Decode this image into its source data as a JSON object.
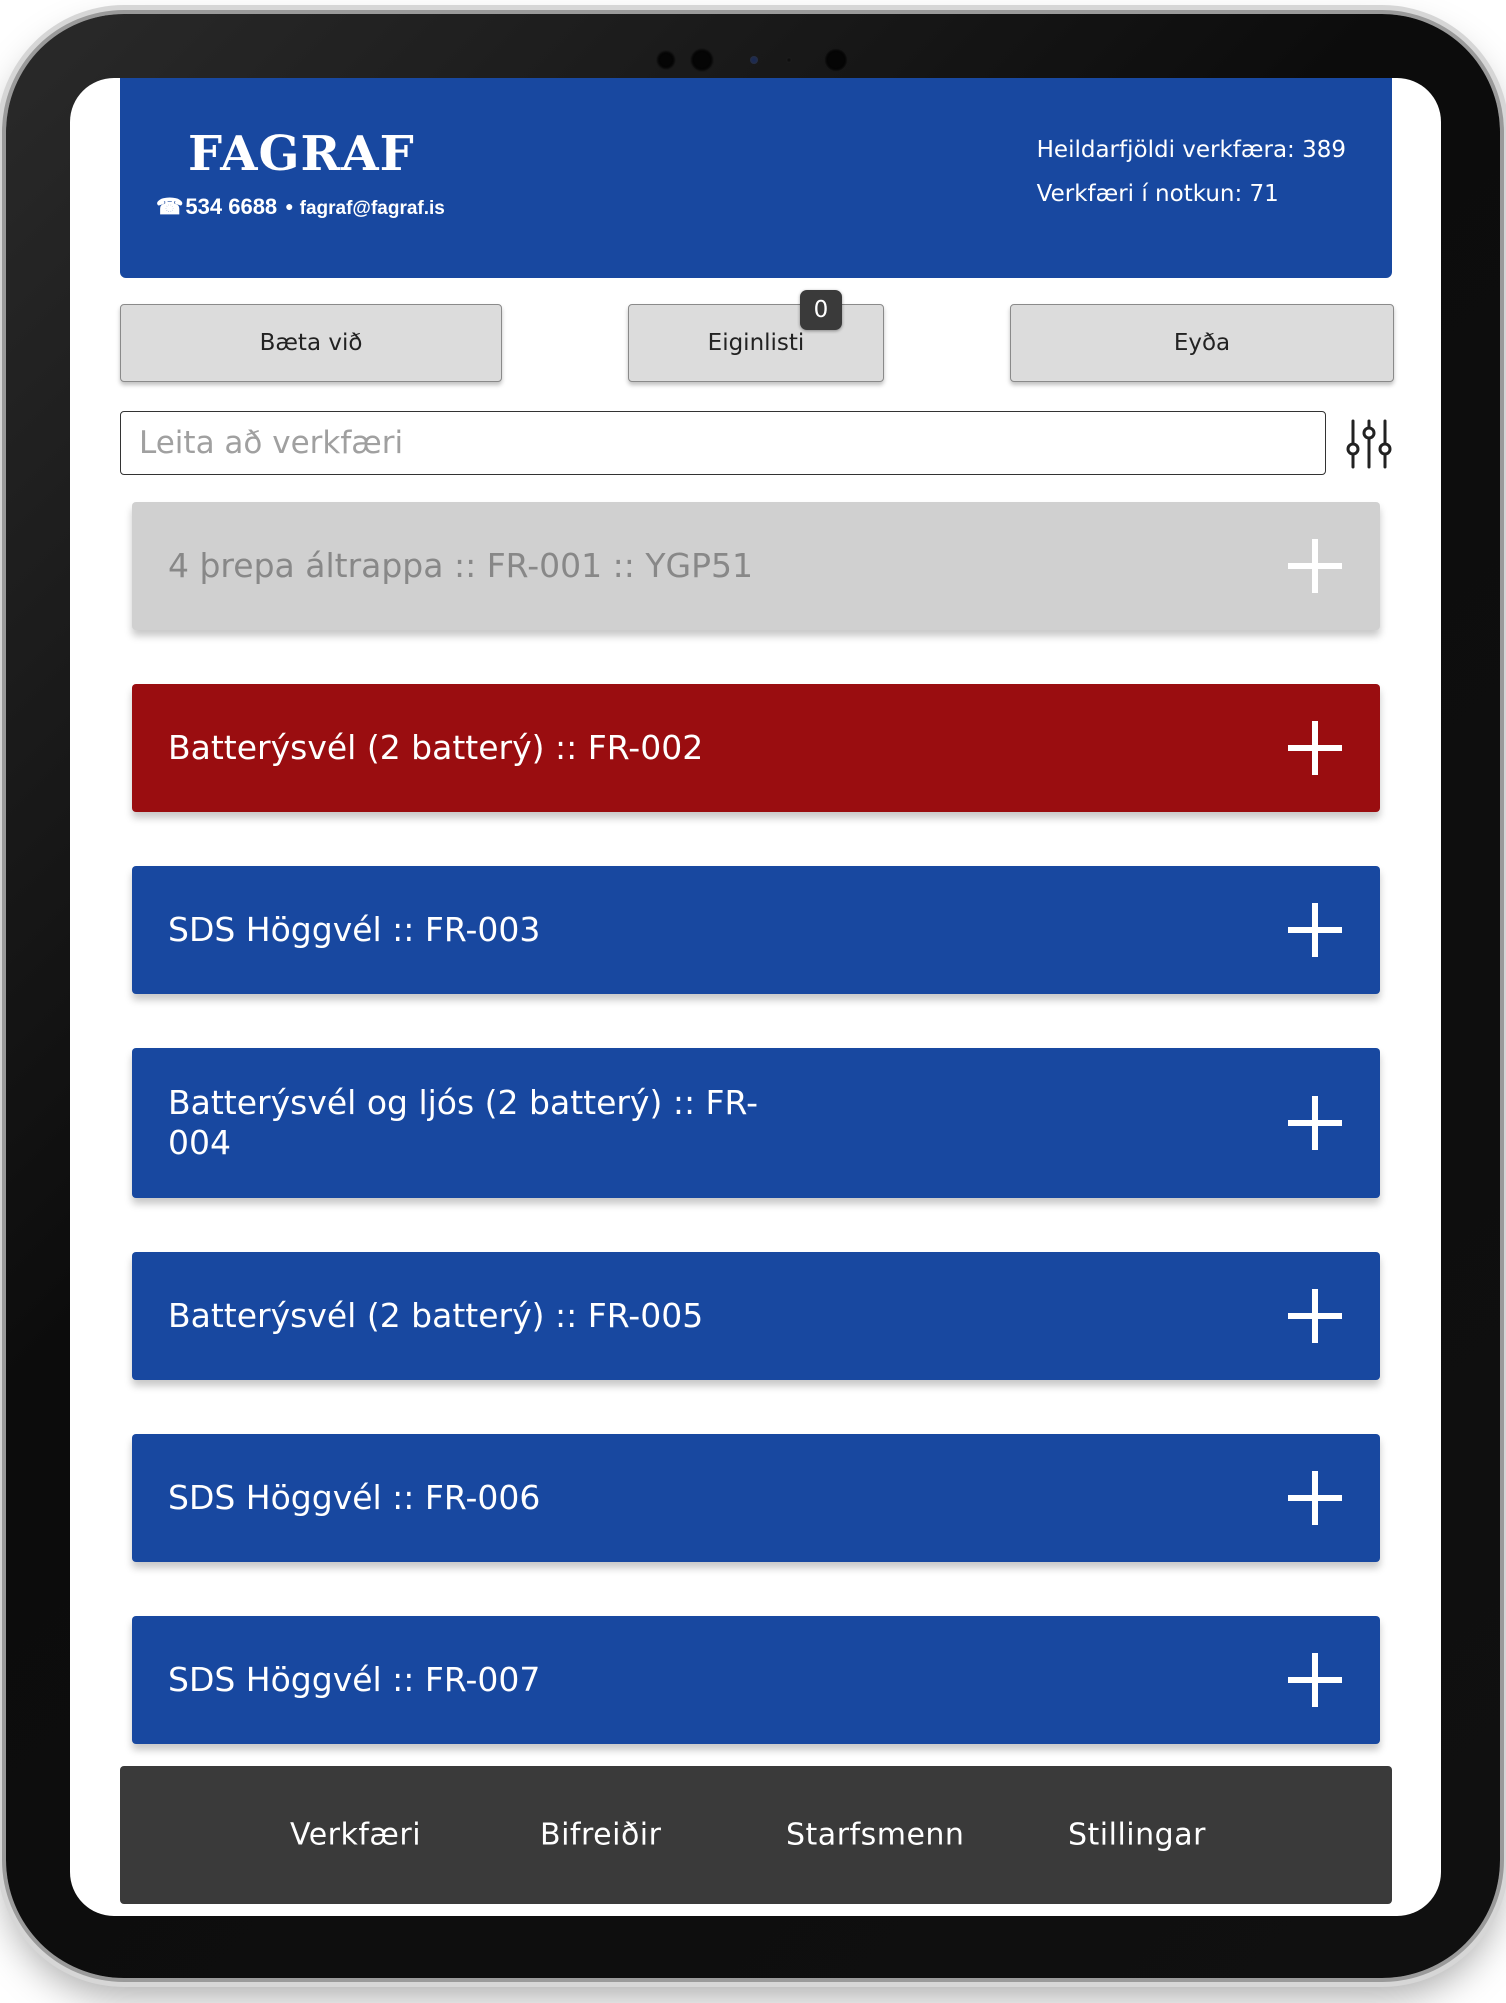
{
  "header": {
    "logo_text": "FAGRAF",
    "phone": "534 6688",
    "email": "fagraf@fagraf.is",
    "total_tools": "Heildarfjöldi verkfæra: 389",
    "tools_in_use": "Verkfæri í notkun: 71"
  },
  "actions": {
    "add_label": "Bæta við",
    "owner_list_label": "Eiginlisti",
    "owner_list_count": "0",
    "delete_label": "Eyða"
  },
  "search": {
    "placeholder": "Leita að verkfæri",
    "filter_icon": "sliders-icon"
  },
  "tools": [
    {
      "label": "4 þrepa áltrappa :: FR-001 :: YGP51",
      "status": "inactive",
      "color": "#d0d0d0"
    },
    {
      "label": "Batterýsvél (2 batterý) :: FR-002",
      "status": "alert",
      "color": "#9a0d10"
    },
    {
      "label": "SDS Höggvél :: FR-003",
      "status": "available",
      "color": "#1848a0"
    },
    {
      "label": "Batterýsvél og ljós (2 batterý) :: FR-004",
      "status": "available",
      "color": "#1848a0"
    },
    {
      "label": "Batterýsvél (2 batterý) :: FR-005",
      "status": "available",
      "color": "#1848a0"
    },
    {
      "label": "SDS Höggvél :: FR-006",
      "status": "available",
      "color": "#1848a0"
    },
    {
      "label": "SDS Höggvél :: FR-007",
      "status": "available",
      "color": "#1848a0"
    }
  ],
  "nav": {
    "tools": "Verkfæri",
    "vehicles": "Bifreiðir",
    "staff": "Starfsmenn",
    "settings": "Stillingar"
  },
  "colors": {
    "brand_blue": "#1848a0",
    "alert_red": "#9a0d10",
    "inactive_grey": "#d0d0d0",
    "nav_bg": "#3a3a3a"
  }
}
